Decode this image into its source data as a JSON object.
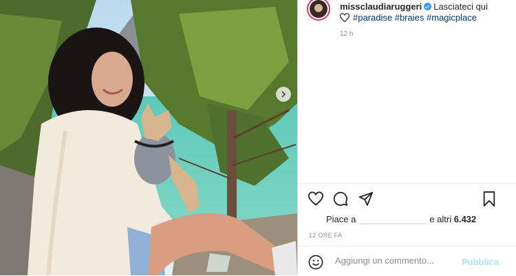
{
  "post": {
    "username": "missclaudiaruggeri",
    "caption": "Lasciateci qui",
    "hashtags": "#paradise #braies #magicplace",
    "timestamp_short": "12 h",
    "likes_prefix": "Piace a",
    "likes_hidden_name": "________________",
    "likes_suffix": "e altri",
    "likes_count": "6.432",
    "time_ago": "12 ORE FA"
  },
  "comment": {
    "placeholder": "Aggiungi un commento...",
    "publish_label": "Pubblica"
  },
  "colors": {
    "verified": "#3897f0",
    "hashtag": "#00376b",
    "publish": "#b2dffc",
    "avatar_ring": "#e1306c"
  },
  "icons": [
    "verified-badge-icon",
    "heart-icon",
    "comment-icon",
    "share-icon",
    "bookmark-icon",
    "emoji-icon",
    "chevron-right-icon"
  ]
}
